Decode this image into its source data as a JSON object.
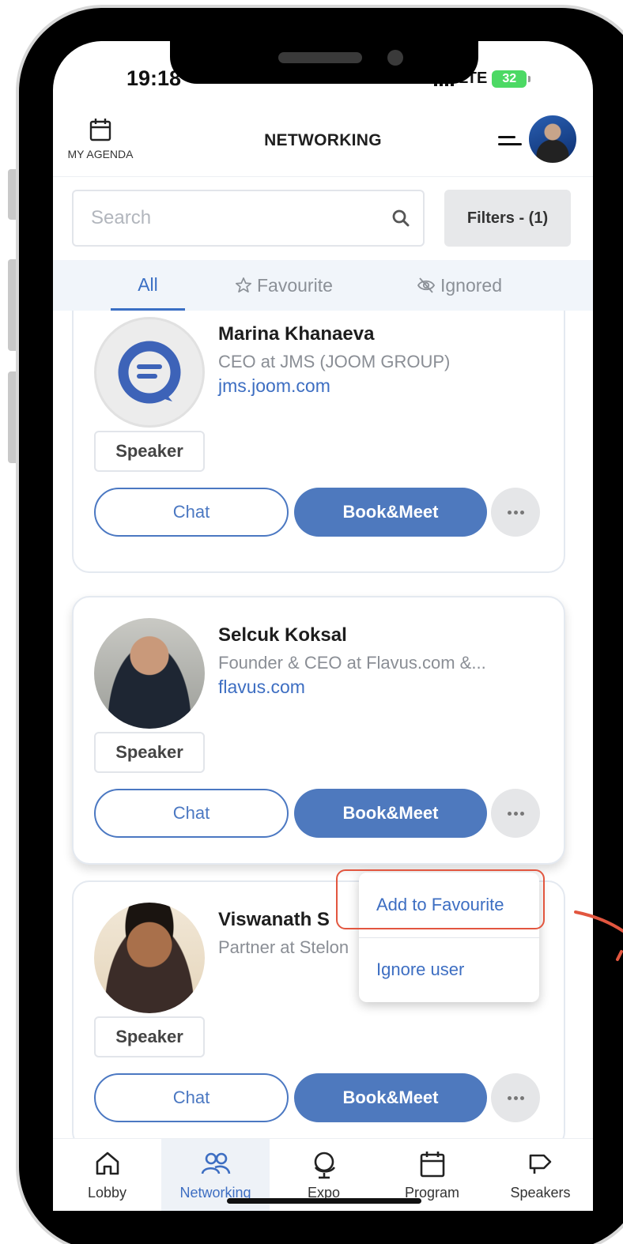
{
  "status_bar": {
    "time": "19:18",
    "network": "LTE",
    "battery": "32"
  },
  "header": {
    "agenda_label": "MY AGENDA",
    "title": "NETWORKING"
  },
  "search": {
    "placeholder": "Search",
    "filters_label": "Filters - (1)"
  },
  "tabs": [
    {
      "label": "All",
      "active": true
    },
    {
      "label": "Favourite",
      "active": false
    },
    {
      "label": "Ignored",
      "active": false
    }
  ],
  "people": [
    {
      "name": "Marina Khanaeva",
      "role": "CEO at JMS (JOOM GROUP)",
      "site": "jms.joom.com",
      "badge": "Speaker",
      "chat_label": "Chat",
      "book_label": "Book&Meet"
    },
    {
      "name": "Selcuk Koksal",
      "role": "Founder & CEO at Flavus.com &...",
      "site": "flavus.com",
      "badge": "Speaker",
      "chat_label": "Chat",
      "book_label": "Book&Meet"
    },
    {
      "name": "Viswanath S",
      "role": "Partner at Stelon",
      "site": "",
      "badge": "Speaker",
      "chat_label": "Chat",
      "book_label": "Book&Meet"
    }
  ],
  "dropdown": {
    "add_favourite": "Add to Favourite",
    "ignore_user": "Ignore user"
  },
  "bottom_nav": [
    {
      "label": "Lobby",
      "icon": "home-icon"
    },
    {
      "label": "Networking",
      "icon": "people-icon",
      "active": true
    },
    {
      "label": "Expo",
      "icon": "globe-icon"
    },
    {
      "label": "Program",
      "icon": "calendar-icon"
    },
    {
      "label": "Speakers",
      "icon": "megaphone-icon"
    }
  ],
  "colors": {
    "accent": "#4e79be",
    "link": "#3d6ec2",
    "highlight": "#e2563f"
  }
}
